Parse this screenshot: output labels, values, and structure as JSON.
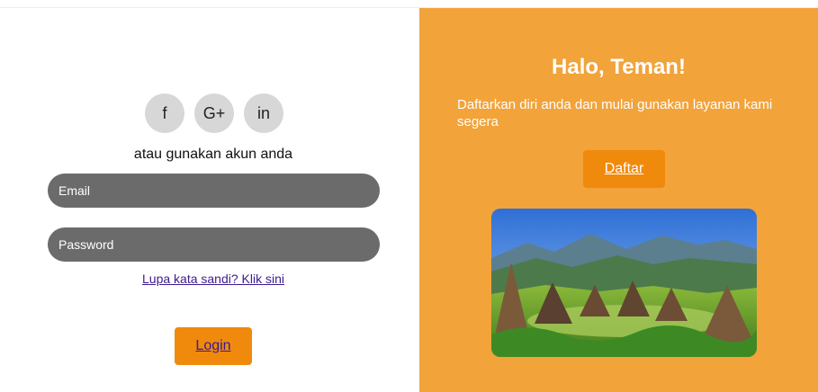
{
  "social": {
    "facebook": "f",
    "google": "G+",
    "linkedin": "in"
  },
  "login": {
    "alt_text": "atau gunakan akun anda",
    "email_placeholder": "Email",
    "password_placeholder": "Password",
    "forgot_link": "Lupa kata sandi? Klik sini",
    "login_label": "Login"
  },
  "signup": {
    "title": "Halo, Teman!",
    "description": "Daftarkan diri anda dan mulai gunakan layanan kami segera",
    "signup_label": "Daftar"
  },
  "colors": {
    "panel_orange": "#f2a33a",
    "button_orange": "#f08a0c",
    "input_gray": "#6b6b6b",
    "social_gray": "#d7d7d7",
    "link_purple": "#3c1a8f"
  }
}
